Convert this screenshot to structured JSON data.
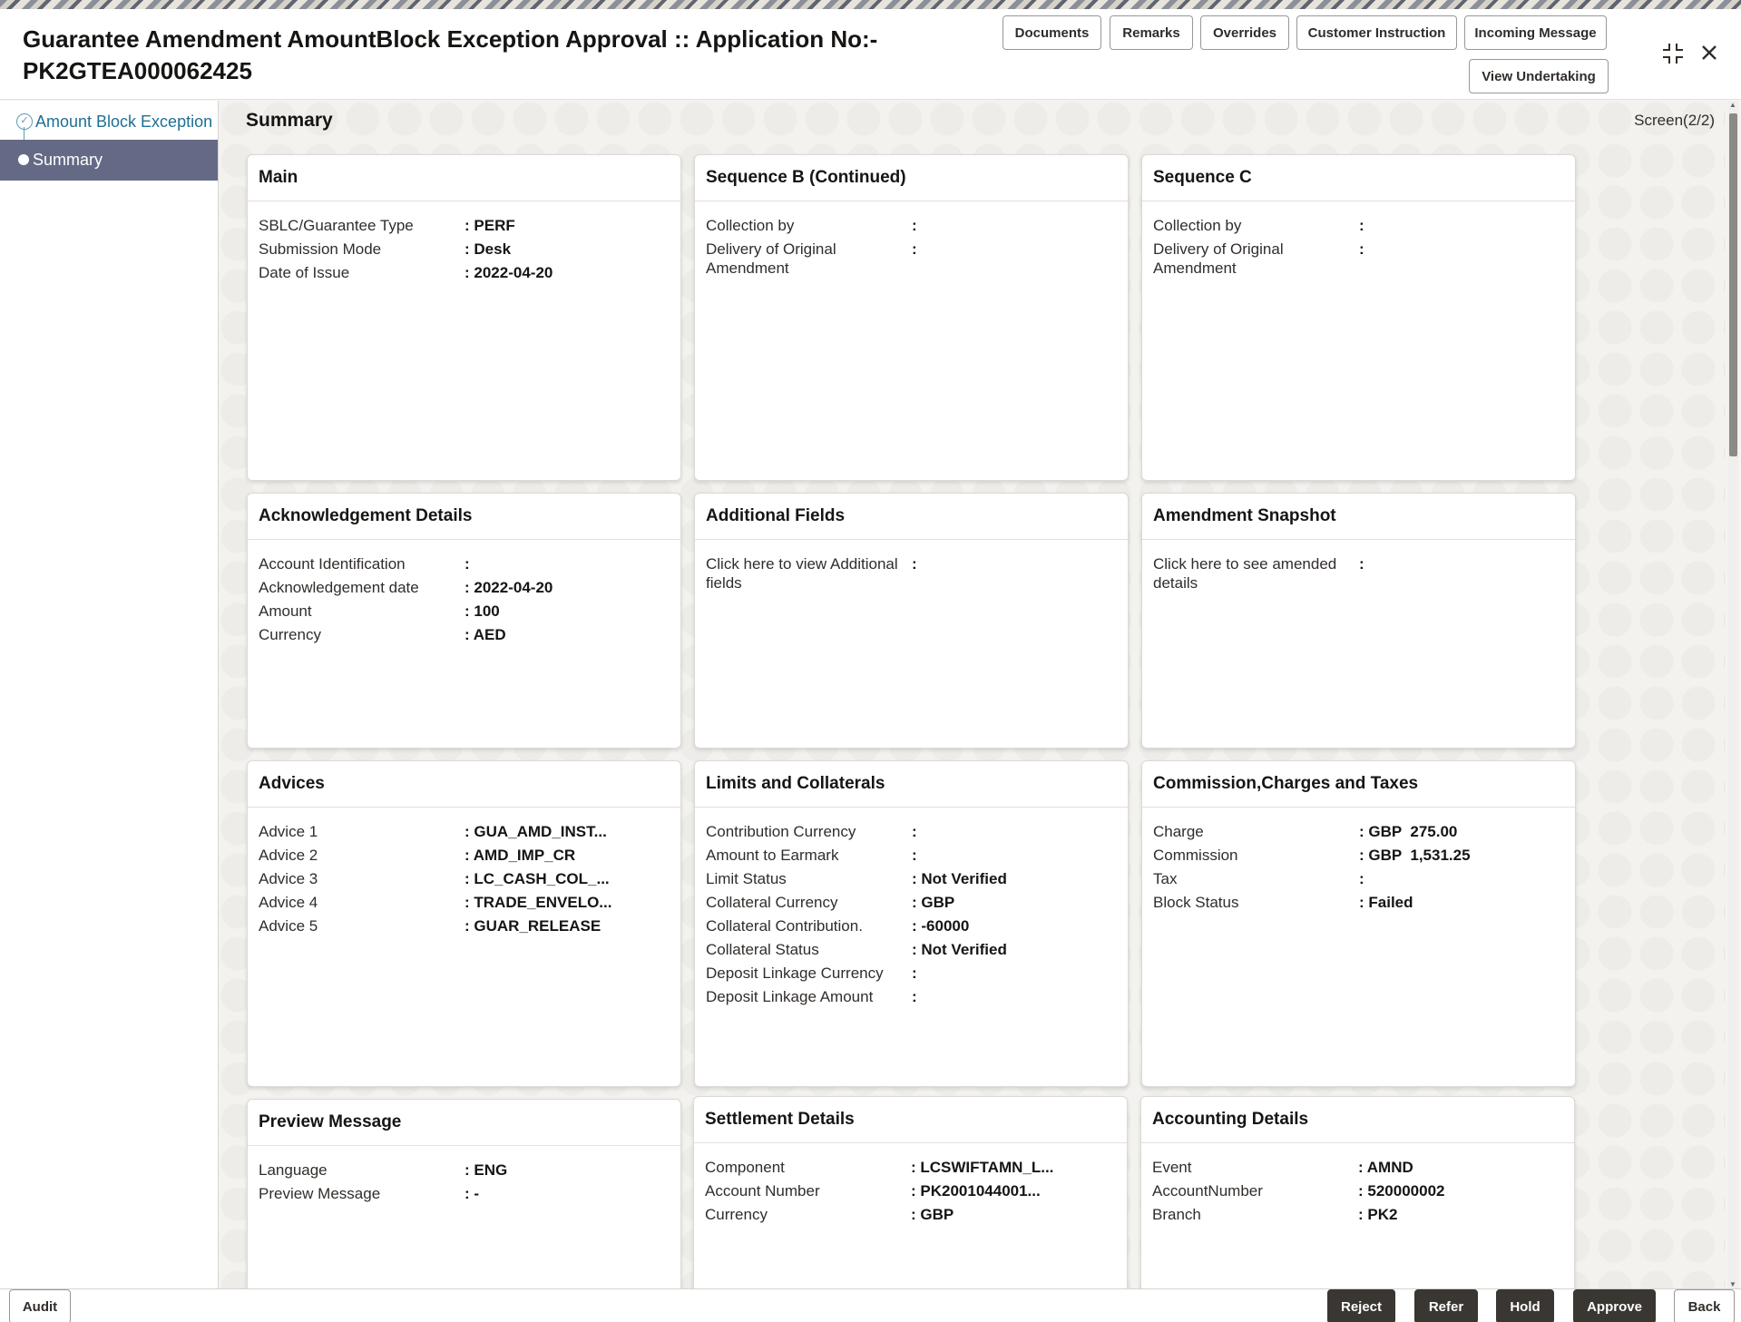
{
  "header": {
    "title": "Guarantee Amendment AmountBlock Exception Approval :: Application No:- PK2GTEA000062425",
    "buttons": {
      "documents": "Documents",
      "remarks": "Remarks",
      "overrides": "Overrides",
      "customer_instruction": "Customer Instruction",
      "incoming_message": "Incoming Message",
      "view_undertaking": "View Undertaking"
    },
    "icons": {
      "minimize": "collapse-icon",
      "close": "close-icon"
    }
  },
  "sidebar": {
    "items": [
      {
        "label": "Amount Block Exception",
        "state": "completed"
      },
      {
        "label": "Summary",
        "state": "active"
      }
    ]
  },
  "main": {
    "page_title": "Summary",
    "screen_indicator": "Screen(2/2)"
  },
  "cards": {
    "main": {
      "title": "Main",
      "rows": [
        {
          "k": "SBLC/Guarantee Type",
          "v": "PERF"
        },
        {
          "k": "Submission Mode",
          "v": "Desk"
        },
        {
          "k": "Date of Issue",
          "v": "2022-04-20"
        }
      ]
    },
    "sequence_b": {
      "title": "Sequence B (Continued)",
      "rows": [
        {
          "k": "Collection by",
          "v": ""
        },
        {
          "k": "Delivery of Original Amendment",
          "v": ""
        }
      ]
    },
    "sequence_c": {
      "title": "Sequence C",
      "rows": [
        {
          "k": "Collection by",
          "v": ""
        },
        {
          "k": "Delivery of Original Amendment",
          "v": ""
        }
      ]
    },
    "acknowledgement": {
      "title": "Acknowledgement Details",
      "rows": [
        {
          "k": "Account Identification",
          "v": ""
        },
        {
          "k": "Acknowledgement date",
          "v": "2022-04-20"
        },
        {
          "k": "Amount",
          "v": "100"
        },
        {
          "k": "Currency",
          "v": "AED"
        }
      ]
    },
    "additional_fields": {
      "title": "Additional Fields",
      "rows": [
        {
          "k": "Click here to view Additional fields",
          "v": ""
        }
      ]
    },
    "amendment_snapshot": {
      "title": "Amendment Snapshot",
      "rows": [
        {
          "k": "Click here to see amended details",
          "v": ""
        }
      ]
    },
    "advices": {
      "title": "Advices",
      "rows": [
        {
          "k": "Advice 1",
          "v": "GUA_AMD_INST..."
        },
        {
          "k": "Advice 2",
          "v": "AMD_IMP_CR"
        },
        {
          "k": "Advice 3",
          "v": "LC_CASH_COL_..."
        },
        {
          "k": "Advice 4",
          "v": "TRADE_ENVELO..."
        },
        {
          "k": "Advice 5",
          "v": "GUAR_RELEASE"
        }
      ]
    },
    "limits": {
      "title": "Limits and Collaterals",
      "rows": [
        {
          "k": "Contribution Currency",
          "v": ""
        },
        {
          "k": "Amount to Earmark",
          "v": ""
        },
        {
          "k": "Limit Status",
          "v": "Not Verified"
        },
        {
          "k": "Collateral Currency",
          "v": "GBP"
        },
        {
          "k": "Collateral Contribution.",
          "v": "-60000"
        },
        {
          "k": "Collateral Status",
          "v": "Not Verified"
        },
        {
          "k": "Deposit Linkage Currency",
          "v": ""
        },
        {
          "k": "Deposit Linkage Amount",
          "v": ""
        }
      ]
    },
    "commission": {
      "title": "Commission,Charges and Taxes",
      "rows": [
        {
          "k": "Charge",
          "v": "GBP  275.00"
        },
        {
          "k": "Commission",
          "v": "GBP  1,531.25"
        },
        {
          "k": "Tax",
          "v": ""
        },
        {
          "k": "Block Status",
          "v": "Failed"
        }
      ]
    },
    "preview": {
      "title": "Preview Message",
      "rows": [
        {
          "k": "Language",
          "v": "ENG"
        },
        {
          "k": "Preview Message",
          "v": "-"
        }
      ]
    },
    "settlement": {
      "title": "Settlement Details",
      "rows": [
        {
          "k": "Component",
          "v": "LCSWIFTAMN_L..."
        },
        {
          "k": "Account Number",
          "v": "PK2001044001..."
        },
        {
          "k": "Currency",
          "v": "GBP"
        }
      ]
    },
    "accounting": {
      "title": "Accounting Details",
      "rows": [
        {
          "k": "Event",
          "v": "AMND"
        },
        {
          "k": "AccountNumber",
          "v": "520000002"
        },
        {
          "k": "Branch",
          "v": "PK2"
        }
      ]
    }
  },
  "footer": {
    "audit": "Audit",
    "reject": "Reject",
    "refer": "Refer",
    "hold": "Hold",
    "approve": "Approve",
    "back": "Back"
  }
}
